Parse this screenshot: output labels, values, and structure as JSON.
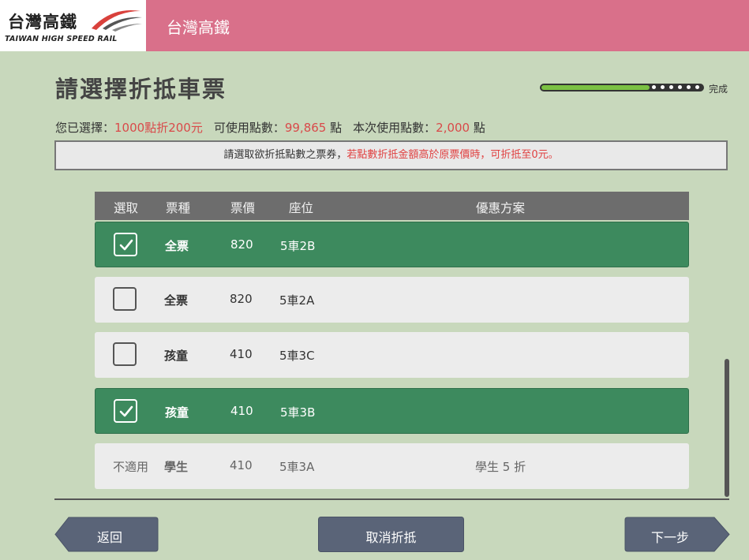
{
  "header": {
    "logo_cn": "台灣高鐵",
    "logo_en": "TAIWAN HIGH SPEED RAIL",
    "title": "台灣高鐵"
  },
  "page": {
    "title": "請選擇折抵車票"
  },
  "progress": {
    "label": "完成",
    "fraction": 0.67
  },
  "summary": {
    "selected_label": "您已選擇：",
    "selected_value": "1000點折200元",
    "available_label": "可使用點數：",
    "available_value": "99,865",
    "available_unit": "點",
    "used_label": "本次使用點數：",
    "used_value": "2,000",
    "used_unit": "點"
  },
  "notice": {
    "text": "請選取欲折抵點數之票券，",
    "highlight": "若點數折抵金額高於原票價時，可折抵至0元。"
  },
  "table": {
    "headers": [
      "選取",
      "票種",
      "票價",
      "座位",
      "優惠方案"
    ],
    "rows": [
      {
        "status": "selected",
        "type": "全票",
        "price": "820",
        "seat": "5車2B",
        "plan": ""
      },
      {
        "status": "unselected",
        "type": "全票",
        "price": "820",
        "seat": "5車2A",
        "plan": ""
      },
      {
        "status": "unselected",
        "type": "孩童",
        "price": "410",
        "seat": "5車3C",
        "plan": ""
      },
      {
        "status": "selected",
        "type": "孩童",
        "price": "410",
        "seat": "5車3B",
        "plan": ""
      },
      {
        "status": "not_applicable",
        "status_text": "不適用",
        "type": "學生",
        "price": "410",
        "seat": "5車3A",
        "plan": "學生 5 折"
      }
    ]
  },
  "buttons": {
    "back": "返回",
    "cancel": "取消折抵",
    "next": "下一步"
  },
  "colors": {
    "header_bg": "#d9708a",
    "page_bg": "#c8d8bc",
    "selected_row": "#3d8a5e",
    "accent_red": "#d94a4a",
    "progress_fill": "#7bc143",
    "button_bg": "#5a6478"
  },
  "icons": {
    "checkbox_checked": "checkmark-icon",
    "logo_mark": "thsr-logo-swoosh"
  }
}
